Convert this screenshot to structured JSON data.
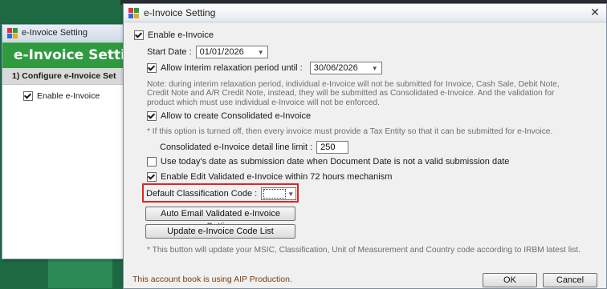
{
  "background_window": {
    "title": "e-Invoice Setting",
    "banner": "e-Invoice Settin",
    "step": "1) Configure e-Invoice Set",
    "enable_label": "Enable e-Invoice"
  },
  "dialog": {
    "title": "e-Invoice Setting",
    "close_glyph": "✕",
    "enable_einvoice": {
      "label": "Enable e-Invoice",
      "checked": true
    },
    "start_date": {
      "label": "Start Date :",
      "value": "01/01/2026"
    },
    "interim": {
      "label": "Allow Interim relaxation period until :",
      "checked": true,
      "value": "30/06/2026"
    },
    "interim_note": [
      "Note: during interim relaxation period, individual e-Invoice will not be submitted for Invoice, Cash Sale, Debit Note,",
      "Credit Note and A/R Credit Note, instead, they will be submitted as Consolidated e-Invoice. And the validation for",
      "product which must use individual e-Invoice will not be enforced."
    ],
    "consolidated": {
      "label": "Allow to create Consolidated e-Invoice",
      "checked": true
    },
    "consolidated_note": "* If this option is turned off, then every invoice must provide a Tax Entity so that it can be submitted for e-Invoice.",
    "detail_limit": {
      "label": "Consolidated e-Invoice detail line limit :",
      "value": "250"
    },
    "todays_date": {
      "label": "Use today's date as submission date when Document Date is not a valid submission date",
      "checked": false
    },
    "edit_validated": {
      "label": "Enable Edit Validated e-Invoice within 72 hours mechanism",
      "checked": true
    },
    "classification": {
      "label": "Default Classification Code :",
      "value": ""
    },
    "auto_email_button": "Auto Email Validated e-Invoice Setting",
    "update_code_button": "Update e-Invoice Code List",
    "update_note": "* This button will update your MSIC, Classification, Unit of Measurement and Country code according to IRBM latest list.",
    "footer_note": "This account book is using AIP Production.",
    "ok_button": "OK",
    "cancel_button": "Cancel"
  },
  "colors": {
    "banner_green": "#2f9a40",
    "highlight_red": "#e4231f",
    "footer_text": "#7a3b10"
  }
}
